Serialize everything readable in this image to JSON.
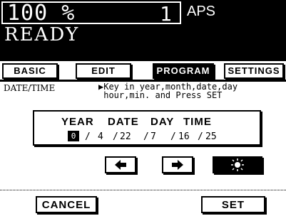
{
  "status": {
    "zoom": "100 %",
    "copies": "1",
    "paper_mode": "APS",
    "state": "READY"
  },
  "tabs": [
    {
      "label": "BASIC"
    },
    {
      "label": "EDIT"
    },
    {
      "label": "PROGRAM"
    },
    {
      "label": "SETTINGS"
    }
  ],
  "section": {
    "label": "DATE/TIME",
    "message_line1": "▶Key in year,month,date,day",
    "message_line2": " hour,min. and Press SET"
  },
  "datetime": {
    "headers": {
      "year": "YEAR",
      "date": "DATE",
      "day": "DAY",
      "time": "TIME"
    },
    "year_value": "0",
    "month": "4",
    "date": "22",
    "day": "7",
    "hour": "16",
    "minute": "25",
    "sep": "/"
  },
  "actions": {
    "cancel": "CANCEL",
    "set": "SET"
  },
  "icons": {
    "left": "left-arrow-icon",
    "right": "right-arrow-icon",
    "brightness": "brightness-icon"
  }
}
